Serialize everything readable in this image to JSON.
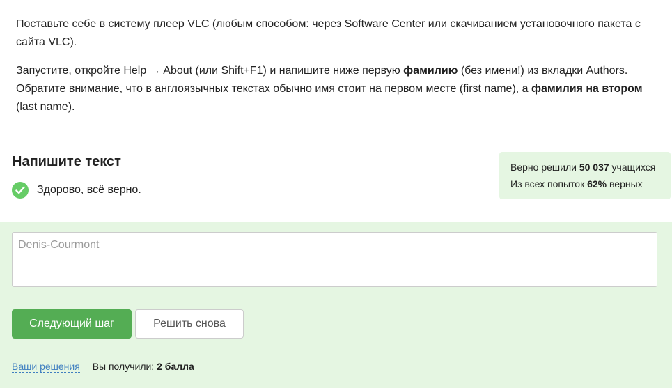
{
  "task": {
    "p1": "Поставьте себе в систему плеер VLC (любым способом: через Software Center или скачиванием установочного пакета с сайта VLC).",
    "p2_a": "Запустите, откройте Help → About (или Shift+F1) и напишите ниже первую ",
    "p2_b": "фамилию",
    "p2_c": " (без имени!) из вкладки Authors. Обратите внимание, что в англоязычных текстах обычно имя стоит на первом месте (first name), а ",
    "p2_d": "фамилия на втором",
    "p2_e": " (last name)."
  },
  "quiz": {
    "title": "Напишите текст",
    "result_text": "Здорово, всё верно.",
    "result_icon": "check-circle-icon"
  },
  "stats": {
    "line1_prefix": "Верно решили ",
    "line1_count": "50 037",
    "line1_suffix": " учащихся",
    "line2_prefix": "Из всех попыток ",
    "line2_percent": "62%",
    "line2_suffix": " верных"
  },
  "answer": {
    "placeholder": "Denis-Courmont",
    "value": ""
  },
  "buttons": {
    "next_label": "Следующий шаг",
    "retry_label": "Решить снова"
  },
  "footer": {
    "solutions_link": "Ваши решения",
    "score_prefix": "Вы получили: ",
    "score_value": "2 балла"
  },
  "colors": {
    "accent_green": "#54ad54",
    "panel_green": "#e5f6e2",
    "check_green": "#66cc66",
    "link_blue": "#3f7fc0"
  }
}
